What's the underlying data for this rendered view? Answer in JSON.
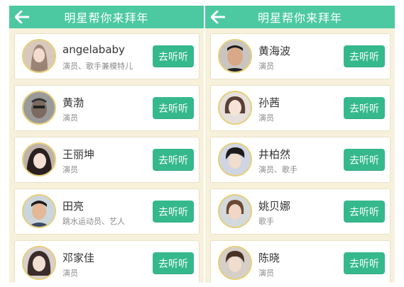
{
  "colors": {
    "header": "#4cc9a1",
    "button": "#35b98c",
    "background": "#f7f1dc"
  },
  "left": {
    "title": "明星帮你来拜年",
    "back_icon": "back-arrow-icon",
    "items": [
      {
        "name": "angelababy",
        "role": "演员、歌手兼模特儿",
        "button": "去听听"
      },
      {
        "name": "黄渤",
        "role": "演员",
        "button": "去听听"
      },
      {
        "name": "王丽坤",
        "role": "演员",
        "button": "去听听"
      },
      {
        "name": "田亮",
        "role": "跳水运动员、艺人",
        "button": "去听听"
      },
      {
        "name": "邓家佳",
        "role": "演员",
        "button": "去听听"
      }
    ]
  },
  "right": {
    "title": "明星帮你来拜年",
    "back_icon": "back-arrow-icon",
    "items": [
      {
        "name": "黄海波",
        "role": "演员",
        "button": "去听听"
      },
      {
        "name": "孙茜",
        "role": "演员",
        "button": "去听听"
      },
      {
        "name": "井柏然",
        "role": "演员、歌手",
        "button": "去听听"
      },
      {
        "name": "姚贝娜",
        "role": "歌手",
        "button": "去听听"
      },
      {
        "name": "陈晓",
        "role": "演员",
        "button": "去听听"
      }
    ]
  }
}
